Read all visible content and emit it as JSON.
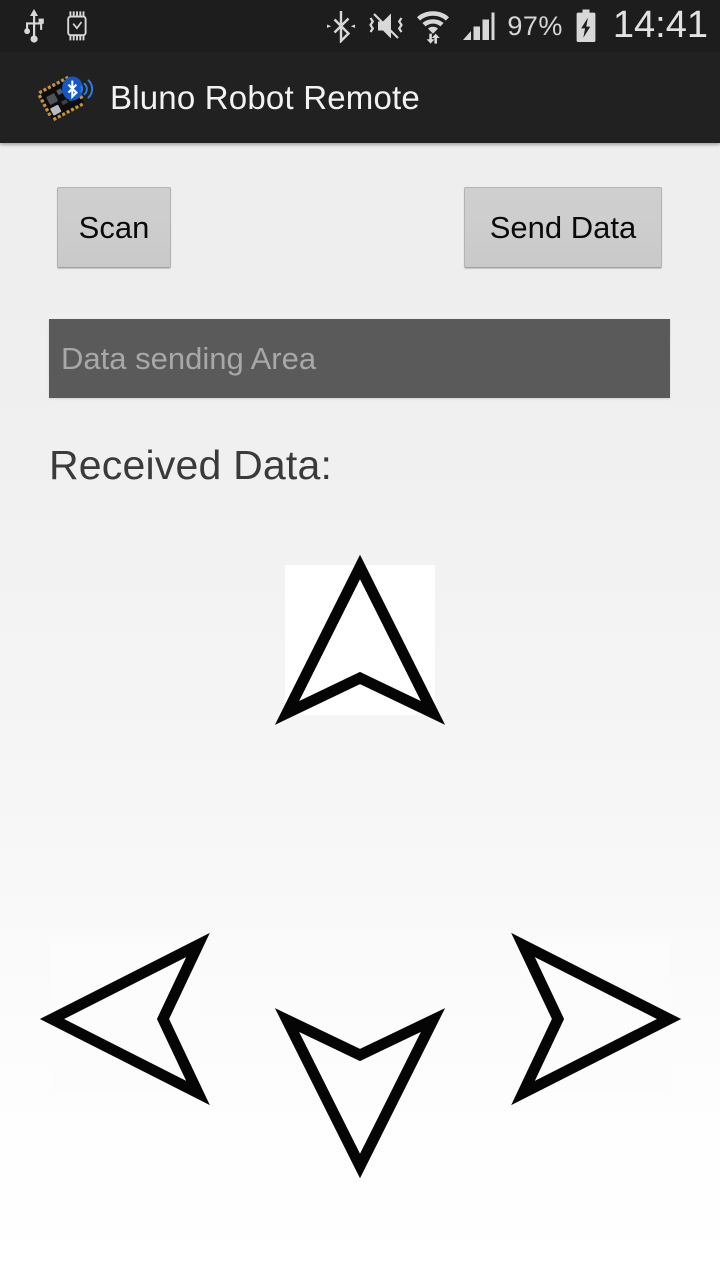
{
  "status_bar": {
    "background_color": "#1d1d1d",
    "left_icons": [
      {
        "name": "usb-icon",
        "label": "USB connected"
      },
      {
        "name": "smartwatch-icon",
        "label": "Watch connected"
      }
    ],
    "right_icons": [
      {
        "name": "bluetooth-icon",
        "label": "Bluetooth on"
      },
      {
        "name": "mute-vibrate-icon",
        "label": "Sound muted"
      },
      {
        "name": "wifi-icon",
        "label": "Wi-Fi connected"
      },
      {
        "name": "cellular-signal-icon",
        "label": "Mobile signal"
      }
    ],
    "battery_percent": "97%",
    "battery_icon": "battery-charging-icon",
    "clock": "14:41"
  },
  "action_bar": {
    "background_color": "#212121",
    "icon_name": "bluno-app-icon",
    "title": "Bluno Robot Remote"
  },
  "main": {
    "background_color": "#eeeeee",
    "scan_button": {
      "label": "Scan",
      "name": "scan-button"
    },
    "send_data_button": {
      "label": "Send Data",
      "name": "send-data-button"
    },
    "data_sending_input": {
      "placeholder": "Data sending Area",
      "value": "",
      "background_color": "#5a5a5a",
      "placeholder_color": "#a8a8a8"
    },
    "received_data_label": "Received Data:",
    "dpad": {
      "up": {
        "name": "arrow-up-button",
        "direction": "up",
        "icon": "arrow-up-icon"
      },
      "left": {
        "name": "arrow-left-button",
        "direction": "left",
        "icon": "arrow-left-icon"
      },
      "right": {
        "name": "arrow-right-button",
        "direction": "right",
        "icon": "arrow-right-icon"
      },
      "down": {
        "name": "arrow-down-button",
        "direction": "down",
        "icon": "arrow-down-icon"
      }
    }
  }
}
